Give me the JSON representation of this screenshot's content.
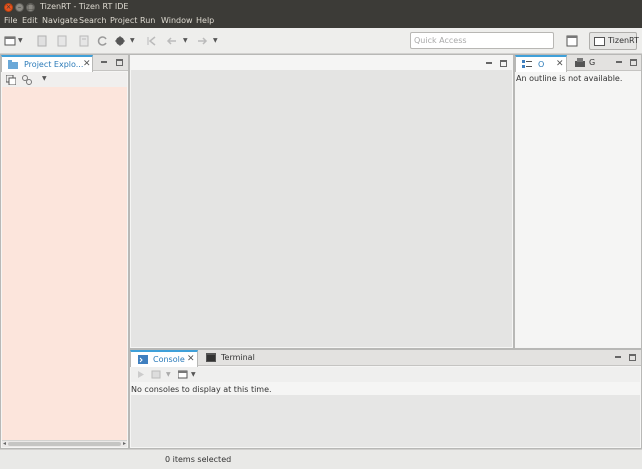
{
  "window": {
    "title": "TizenRT - Tizen RT IDE",
    "close_glyph": "×",
    "min_glyph": "–",
    "max_glyph": "□"
  },
  "menu": [
    "File",
    "Edit",
    "Navigate",
    "Search",
    "Project",
    "Run",
    "Window",
    "Help"
  ],
  "toolbar": {
    "quick_access_placeholder": "Quick Access",
    "perspective_label": "TizenRT"
  },
  "project_explorer": {
    "tab_label": "Project Explo...",
    "close_glyph": "✕"
  },
  "outline": {
    "tab_label": "O",
    "second_tab_label": "G",
    "close_glyph": "✕",
    "message": "An outline is not available."
  },
  "console": {
    "tab_label": "Console",
    "close_glyph": "✕",
    "terminal_tab_label": "Terminal",
    "message": "No consoles to display at this time."
  },
  "status": {
    "text": "0 items selected"
  },
  "colors": {
    "title_bg": "#3c3b37",
    "close_button": "#e95420",
    "active_tab_accent": "#3fa0d9",
    "explorer_bg": "#fce5dc"
  }
}
